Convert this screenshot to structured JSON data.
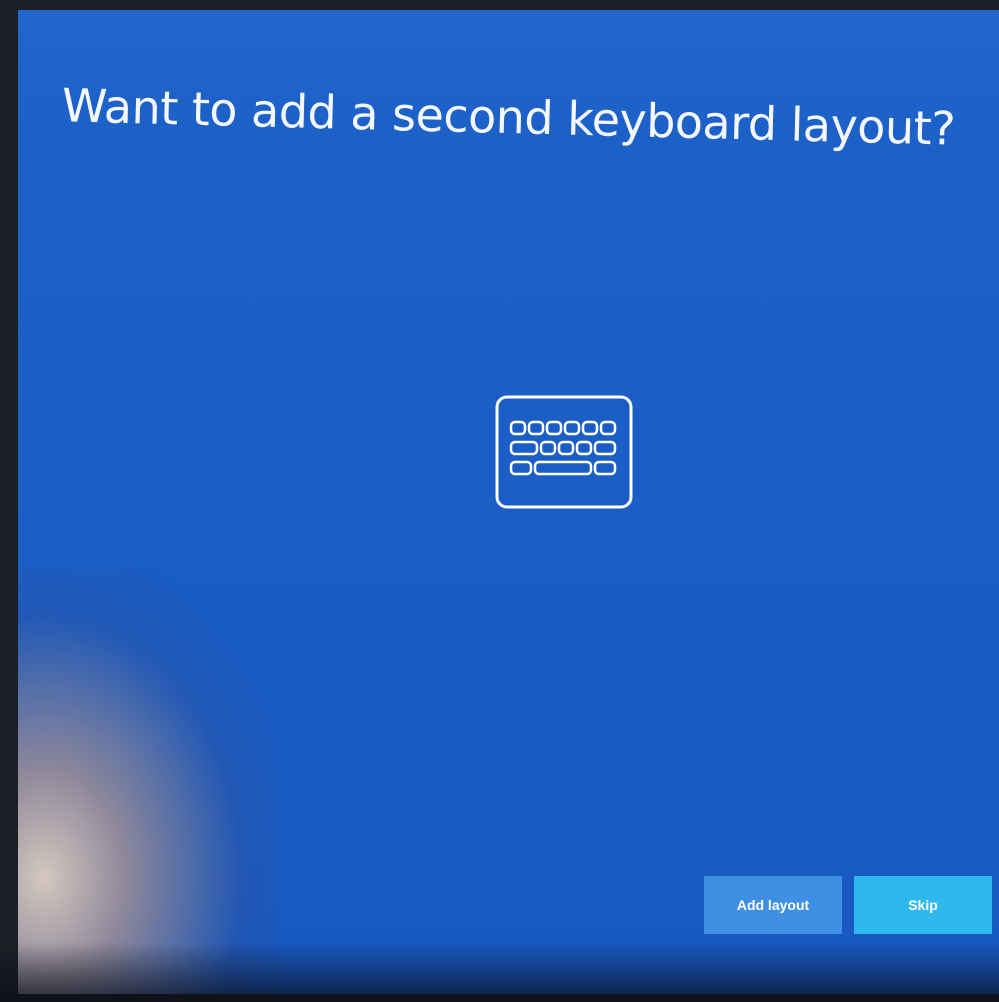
{
  "screen": {
    "title": "Want to add a second keyboard layout?",
    "icon": "keyboard-icon",
    "colors": {
      "background": "#1a5ec6",
      "add_layout_button": "#3f8fe2",
      "skip_button": "#2eb8ee",
      "text": "#ffffff"
    }
  },
  "actions": {
    "add_layout_label": "Add layout",
    "skip_label": "Skip"
  }
}
